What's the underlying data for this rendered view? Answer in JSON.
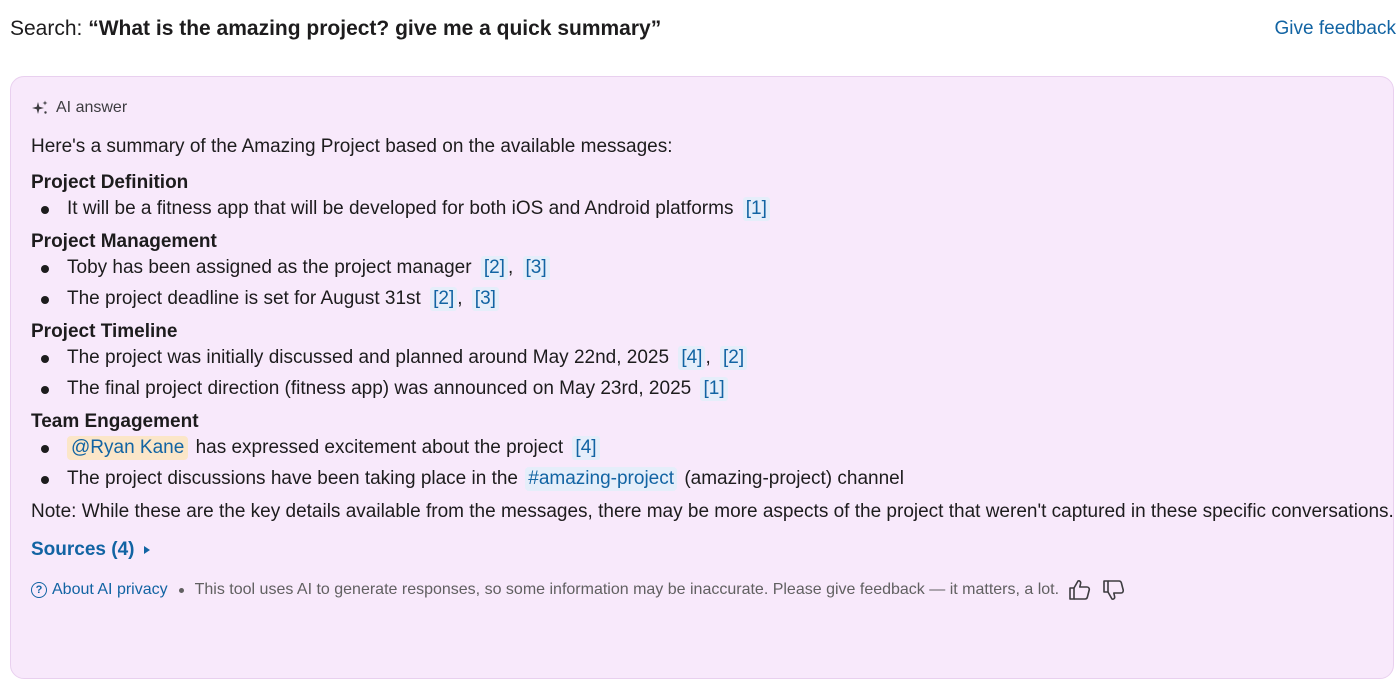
{
  "header": {
    "search_prefix": "Search: ",
    "search_query": "“What is the amazing project? give me a quick summary”",
    "feedback_link": "Give feedback"
  },
  "answer": {
    "label": "AI answer",
    "label_icon": "sparkle-icon",
    "intro": "Here's a summary of the Amazing Project based on the available messages:",
    "sections": [
      {
        "heading": "Project Definition",
        "bullets": [
          {
            "text": "It will be a fitness app that will be developed for both iOS and Android platforms",
            "citations": [
              "[1]"
            ]
          }
        ]
      },
      {
        "heading": "Project Management",
        "bullets": [
          {
            "text": "Toby has been assigned as the project manager",
            "citations": [
              "[2]",
              "[3]"
            ]
          },
          {
            "text": "The project deadline is set for August 31st",
            "citations": [
              "[2]",
              "[3]"
            ]
          }
        ]
      },
      {
        "heading": "Project Timeline",
        "bullets": [
          {
            "text": "The project was initially discussed and planned around May 22nd, 2025",
            "citations": [
              "[4]",
              "[2]"
            ]
          },
          {
            "text": "The final project direction (fitness app) was announced on May 23rd, 2025",
            "citations": [
              "[1]"
            ]
          }
        ]
      },
      {
        "heading": "Team Engagement",
        "bullets": [
          {
            "mention": "@Ryan Kane",
            "text": "has expressed excitement about the project",
            "citations": [
              "[4]"
            ]
          },
          {
            "text_before": "The project discussions have been taking place in the",
            "channel": "#amazing-project",
            "text_after": "(amazing-project) channel"
          }
        ]
      }
    ],
    "citation_separator": ",",
    "note": "Note: While these are the key details available from the messages, there may be more aspects of the project that weren't captured in these specific conversations.",
    "sources_label": "Sources (4)"
  },
  "footer": {
    "privacy_icon": "?",
    "privacy_link": "About AI privacy",
    "disclaimer": "This tool uses AI to generate responses, so some information may be inaccurate. Please give feedback — it matters, a lot.",
    "thumbs_up_icon": "thumbs-up-icon",
    "thumbs_down_icon": "thumbs-down-icon"
  },
  "colors": {
    "link": "#1264a3",
    "panel_background": "#f8e9fb",
    "citation_background": "#e5eefa",
    "mention_background": "#fbe6c8"
  }
}
